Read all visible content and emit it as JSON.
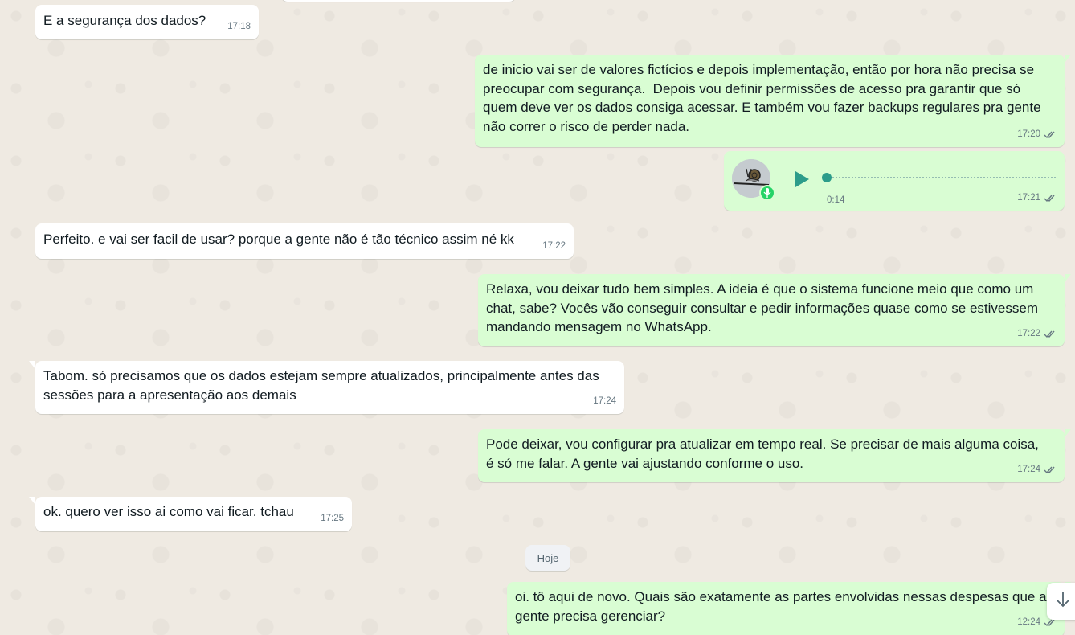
{
  "messages": [
    {
      "id": "m1",
      "text": "E a segurança dos dados?",
      "time": "17:18"
    },
    {
      "id": "m2",
      "text": "de inicio vai ser de valores fictícios e depois implementação, então por hora não precisa se\npreocupar com segurança.  Depois vou definir permissões de acesso pra garantir que só\nquem deve ver os dados consiga acessar. E também vou fazer backups regulares pra gente\nnão correr o risco de perder nada.",
      "time": "17:20"
    },
    {
      "id": "m3",
      "type": "audio",
      "duration": "0:14",
      "time": "17:21"
    },
    {
      "id": "m4",
      "text": "Perfeito. e vai ser facil de usar? porque a gente não é tão técnico assim né kk",
      "time": "17:22"
    },
    {
      "id": "m5",
      "text": "Relaxa, vou deixar tudo bem simples. A ideia é que o sistema funcione meio que como um\nchat, sabe? Vocês vão conseguir consultar e pedir informações quase como se estivessem\nmandando mensagem no WhatsApp.",
      "time": "17:22"
    },
    {
      "id": "m6",
      "text": "Tabom. só precisamos que os dados estejam sempre atualizados, principalmente antes das\nsessões para a apresentação aos demais",
      "time": "17:24"
    },
    {
      "id": "m7",
      "text": "Pode deixar, vou configurar pra atualizar em tempo real. Se precisar de mais alguma coisa,\né só me falar. A gente vai ajustando conforme o uso.",
      "time": "17:24"
    },
    {
      "id": "m8",
      "text": "ok. quero ver isso ai como vai ficar. tchau",
      "time": "17:25"
    },
    {
      "id": "m9",
      "text": "oi. tô aqui de novo. Quais são exatamente as partes envolvidas nessas despesas que a\ngente precisa gerenciar?",
      "time": "12:24"
    }
  ],
  "date_divider": "Hoje",
  "icons": {
    "read_receipt": "double-check-icon",
    "play": "play-icon",
    "mic": "mic-icon",
    "scroll_down": "arrow-down-icon"
  },
  "colors": {
    "outgoing_bubble": "#d9fdd3",
    "incoming_bubble": "#ffffff",
    "chat_background": "#efeae2",
    "audio_accent": "#2c9c8a"
  }
}
